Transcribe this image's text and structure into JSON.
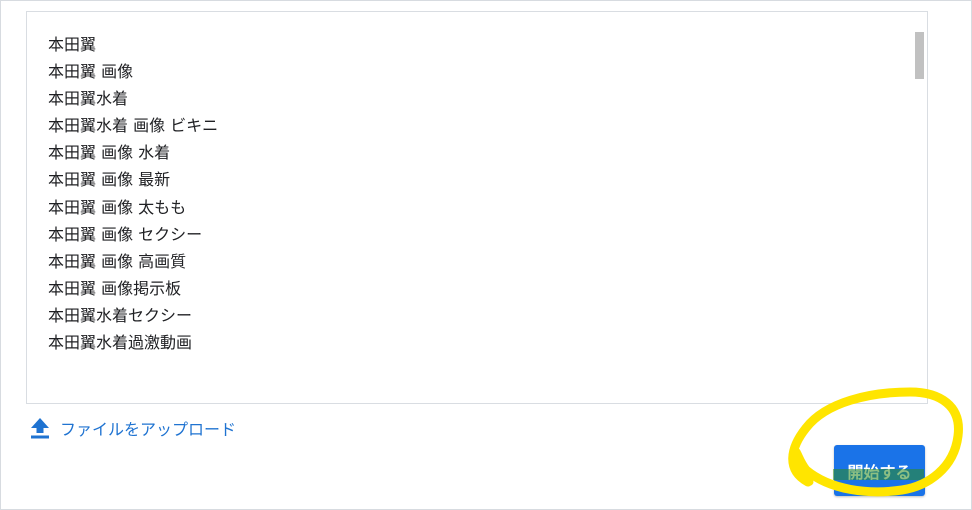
{
  "keywords": [
    "本田翼",
    "本田翼 画像",
    "本田翼水着",
    "本田翼水着 画像 ビキニ",
    "本田翼 画像 水着",
    "本田翼 画像 最新",
    "本田翼 画像 太もも",
    "本田翼 画像 セクシー",
    "本田翼 画像 高画質",
    "本田翼 画像掲示板",
    "本田翼水着セクシー",
    "本田翼水着過激動画"
  ],
  "upload": {
    "label": "ファイルをアップロード",
    "icon": "upload-icon"
  },
  "start_button": {
    "label": "開始する"
  },
  "colors": {
    "link": "#1f73d1",
    "button": "#1a73e8",
    "highlight_annotation": "#ffe500",
    "highlight_green": "#2e8b1e"
  }
}
